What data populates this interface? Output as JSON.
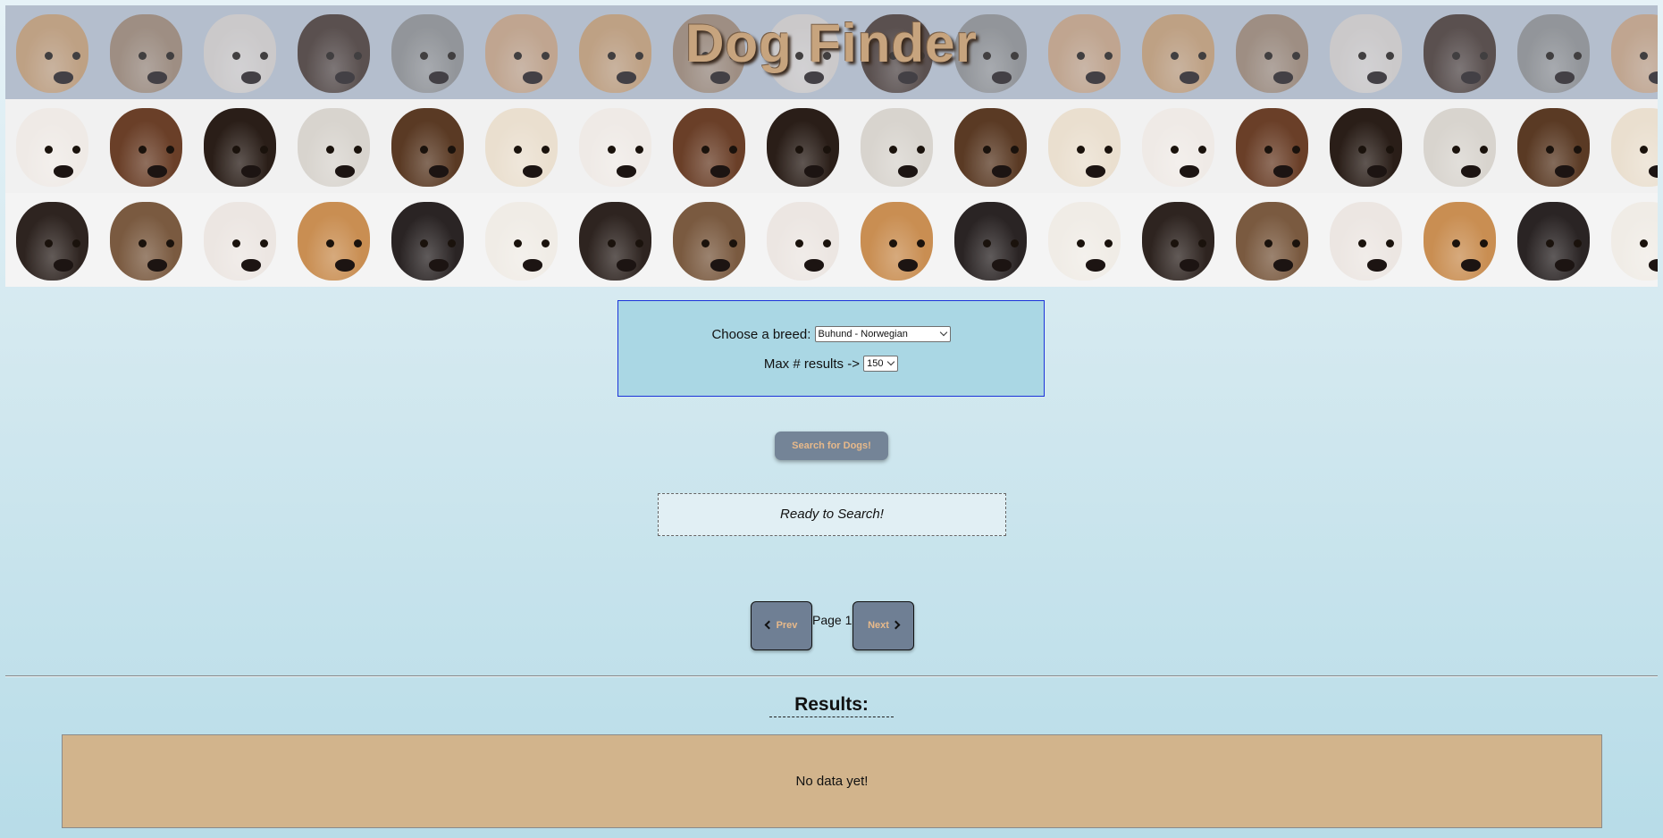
{
  "header": {
    "title": "Dog Finder",
    "mosaic": {
      "rows": [
        {
          "faces": [
            "#c79a6a",
            "#9a8068",
            "#d9d2cb",
            "#3c2a20",
            "#8a8a88",
            "#c9a07a",
            "#c79a6a",
            "#9a8068",
            "#d9d2cb",
            "#3c2a20",
            "#8a8a88",
            "#c9a07a",
            "#c79a6a",
            "#9a8068",
            "#d9d2cb",
            "#3c2a20",
            "#8a8a88",
            "#c9a07a"
          ]
        },
        {
          "faces": [
            "#efeae6",
            "#6a3f28",
            "#2a1e18",
            "#d8d4ce",
            "#5a3a24",
            "#eadfcf",
            "#efeae6",
            "#6a3f28",
            "#2a1e18",
            "#d8d4ce",
            "#5a3a24",
            "#eadfcf",
            "#efeae6",
            "#6a3f28",
            "#2a1e18",
            "#d8d4ce",
            "#5a3a24",
            "#eadfcf"
          ]
        },
        {
          "faces": [
            "#2e2420",
            "#7a5a40",
            "#ece6e2",
            "#c98e52",
            "#2a2424",
            "#f0ece6",
            "#2e2420",
            "#7a5a40",
            "#ece6e2",
            "#c98e52",
            "#2a2424",
            "#f0ece6",
            "#2e2420",
            "#7a5a40",
            "#ece6e2",
            "#c98e52",
            "#2a2424",
            "#f0ece6"
          ]
        }
      ]
    }
  },
  "controls": {
    "breed_label": "Choose a breed:",
    "breed_selected": "Buhund - Norwegian",
    "max_label": "Max # results ->",
    "max_selected": "150"
  },
  "search_button": "Search for Dogs!",
  "status": "Ready to Search!",
  "pager": {
    "prev_label": "Prev",
    "next_label": "Next",
    "page_label": "Page 1"
  },
  "results": {
    "heading": "Results:",
    "empty_message": "No data yet!"
  },
  "colors": {
    "title": "#c7a47e",
    "controls_bg": "#aad7e4",
    "controls_border": "#1b33d9",
    "button_bg": "#748497",
    "button_text": "#e7b98a",
    "results_bg": "#d2b48c"
  }
}
